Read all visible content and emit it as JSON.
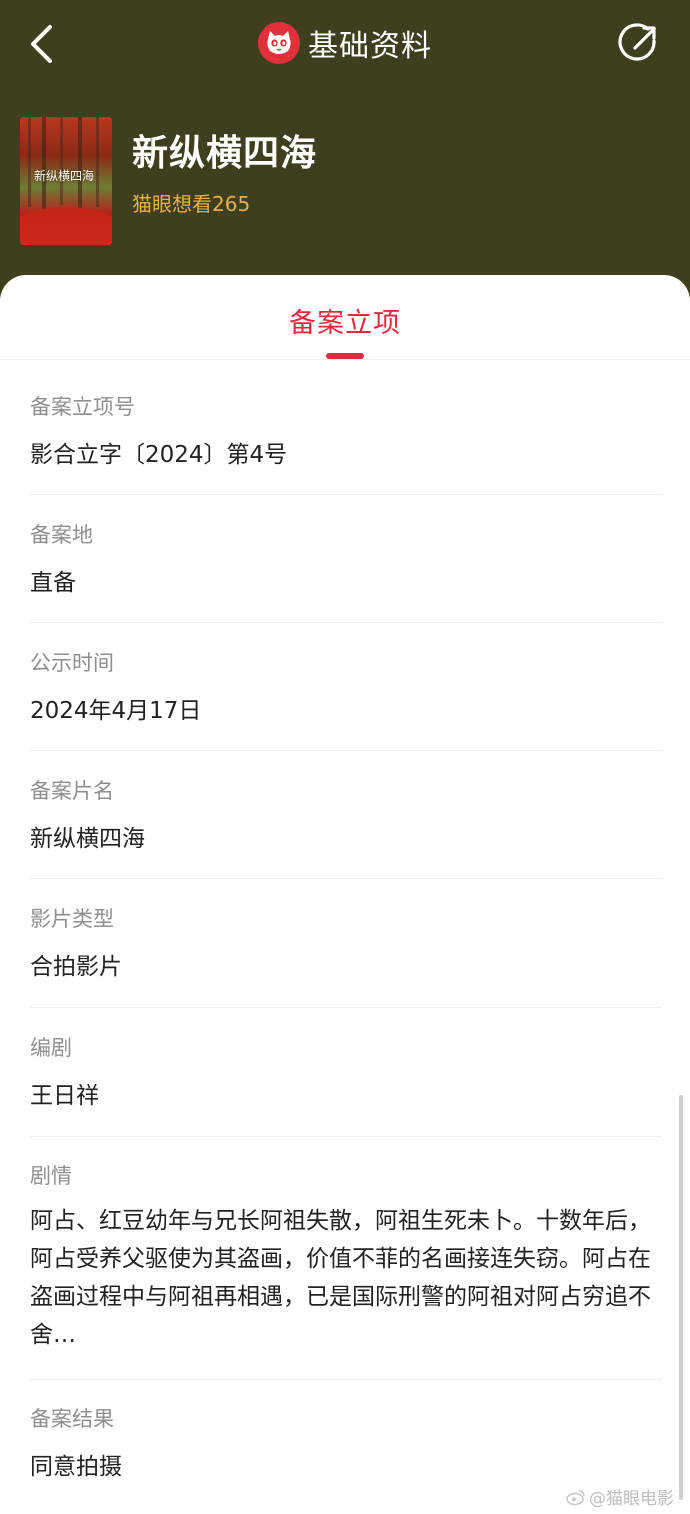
{
  "header": {
    "title": "基础资料",
    "back_icon": "chevron-left-icon",
    "logo_icon": "maoyan-cat-logo",
    "share_icon": "share-icon"
  },
  "movie": {
    "poster_title": "新纵横四海",
    "name": "新纵横四海",
    "want": "猫眼想看265"
  },
  "tab": {
    "label": "备案立项"
  },
  "fields": [
    {
      "label": "备案立项号",
      "value": "影合立字〔2024〕第4号"
    },
    {
      "label": "备案地",
      "value": "直备"
    },
    {
      "label": "公示时间",
      "value": "2024年4月17日"
    },
    {
      "label": "备案片名",
      "value": "新纵横四海"
    },
    {
      "label": "影片类型",
      "value": "合拍影片"
    },
    {
      "label": "编剧",
      "value": "王日祥"
    },
    {
      "label": "剧情",
      "value": "阿占、红豆幼年与兄长阿祖失散，阿祖生死未卜。十数年后，阿占受养父驱使为其盗画，价值不菲的名画接连失窃。阿占在盗画过程中与阿祖再相遇，已是国际刑警的阿祖对阿占穷追不舍…"
    },
    {
      "label": "备案结果",
      "value": "同意拍摄"
    }
  ],
  "watermark": "@猫眼电影",
  "colors": {
    "header_bg": "#3f3f1f",
    "accent": "#dd2a3c",
    "want": "#e8b048"
  }
}
